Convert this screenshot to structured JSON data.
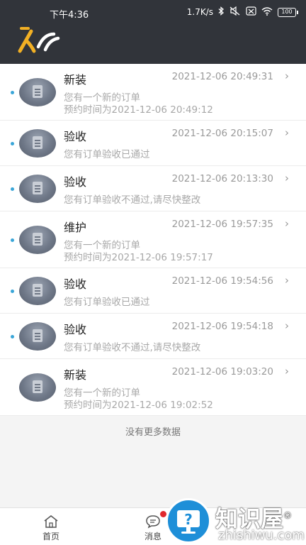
{
  "status": {
    "time": "下午4:36",
    "speed": "1.7K/s",
    "battery": "100"
  },
  "messages": [
    {
      "title": "新装",
      "date": "2021-12-06 20:49:31",
      "lines": [
        "您有一个新的订单",
        "预约时间为2021-12-06 20:49:12"
      ],
      "unread": true
    },
    {
      "title": "验收",
      "date": "2021-12-06 20:15:07",
      "lines": [
        "您有订单验收已通过"
      ],
      "unread": true
    },
    {
      "title": "验收",
      "date": "2021-12-06 20:13:30",
      "lines": [
        "您有订单验收不通过,请尽快整改"
      ],
      "unread": true
    },
    {
      "title": "维护",
      "date": "2021-12-06 19:57:35",
      "lines": [
        "您有一个新的订单",
        "预约时间为2021-12-06 19:57:17"
      ],
      "unread": true
    },
    {
      "title": "验收",
      "date": "2021-12-06 19:54:56",
      "lines": [
        "您有订单验收已通过"
      ],
      "unread": true
    },
    {
      "title": "验收",
      "date": "2021-12-06 19:54:18",
      "lines": [
        "您有订单验收不通过,请尽快整改"
      ],
      "unread": true
    },
    {
      "title": "新装",
      "date": "2021-12-06 19:03:20",
      "lines": [
        "您有一个新的订单",
        "预约时间为2021-12-06 19:02:52"
      ],
      "unread": false
    }
  ],
  "no_more": "没有更多数据",
  "tabs": {
    "home": "首页",
    "messages": "消息"
  },
  "watermark": {
    "text": "知识屋",
    "url": "zhishiwu.com",
    "reg": "®"
  },
  "colors": {
    "header": "#31343a",
    "unread_dot": "#3aa6d8",
    "badge": "#e0292e"
  }
}
